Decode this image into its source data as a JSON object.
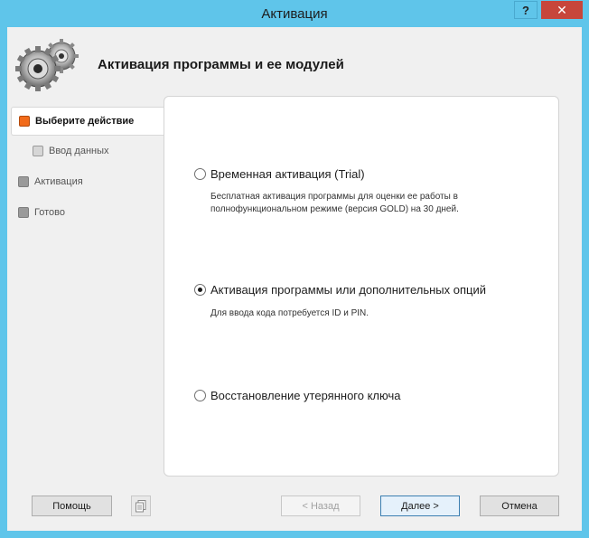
{
  "window": {
    "title": "Активация",
    "help_label": "?",
    "close_label": "✕",
    "accent": "#5fc5ea"
  },
  "header": {
    "title": "Активация программы и ее модулей"
  },
  "steps": [
    {
      "label": "Выберите действие",
      "state": "active"
    },
    {
      "label": "Ввод данных",
      "state": "pending-sub"
    },
    {
      "label": "Активация",
      "state": "pending"
    },
    {
      "label": "Готово",
      "state": "pending"
    }
  ],
  "options": [
    {
      "label": "Временная активация (Trial)",
      "desc": "Бесплатная активация программы для оценки ее работы в полнофункциональном режиме (версия GOLD) на 30 дней.",
      "checked": false
    },
    {
      "label": "Активация программы или дополнительных опций",
      "desc": "Для ввода кода потребуется ID и PIN.",
      "checked": true
    },
    {
      "label": "Восстановление утерянного ключа",
      "desc": "",
      "checked": false
    }
  ],
  "buttons": {
    "help": "Помощь",
    "back": "< Назад",
    "next": "Далее >",
    "cancel": "Отмена"
  },
  "colors": {
    "active_step": "#f26b1a",
    "close_button": "#c7463b"
  }
}
